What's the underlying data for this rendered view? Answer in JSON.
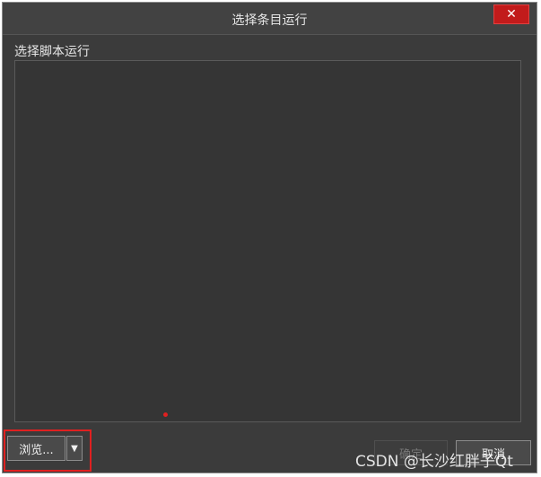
{
  "window": {
    "title": "选择条目运行",
    "close_glyph": "✕"
  },
  "main": {
    "section_label": "选择脚本运行"
  },
  "footer": {
    "browse_label": "浏览...",
    "browse_arrow_glyph": "▼",
    "ok_label": "确定",
    "cancel_label": "取消"
  },
  "watermark": {
    "text": "CSDN @长沙红胖子Qt"
  },
  "colors": {
    "dialog_bg": "#3b3b3b",
    "close_button": "#c21b1b",
    "highlight": "#e02020"
  }
}
